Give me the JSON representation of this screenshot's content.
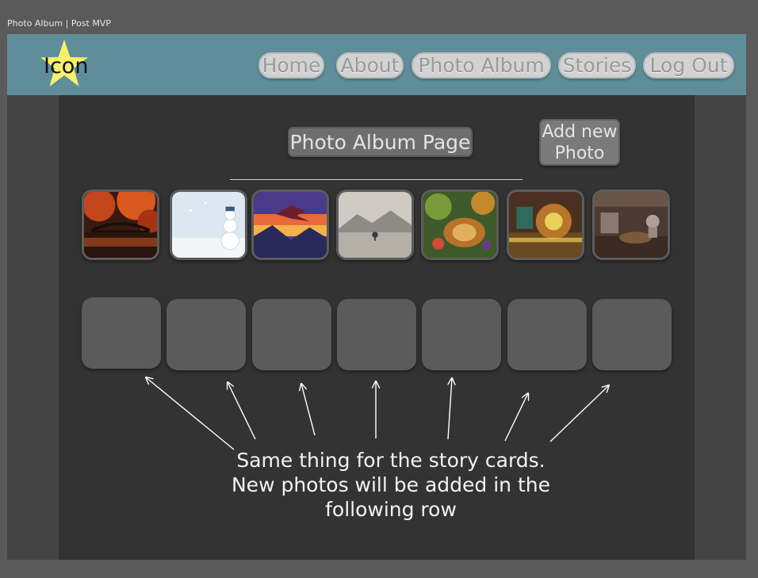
{
  "frame_label": "Photo Album | Post MVP",
  "header": {
    "logo_text": "Icon",
    "logo_color": "#f7f16a",
    "background": "#5f8e9a",
    "nav": [
      {
        "label": "Home"
      },
      {
        "label": "About"
      },
      {
        "label": "Photo Album"
      },
      {
        "label": "Stories"
      },
      {
        "label": "Log Out"
      }
    ]
  },
  "main": {
    "title_button": "Photo Album Page",
    "add_button": "Add new\nPhoto",
    "photos": [
      {
        "icon": "autumn-bridge-photo"
      },
      {
        "icon": "snowman-photo"
      },
      {
        "icon": "dragon-sunset-photo"
      },
      {
        "icon": "misty-landscape-photo"
      },
      {
        "icon": "fantasy-creature-photo"
      },
      {
        "icon": "fantasy-machine-photo"
      },
      {
        "icon": "tavern-interior-photo"
      }
    ],
    "story_cards": 7,
    "note_lines": [
      "Same thing for the story cards.",
      "New photos will be added in the",
      "following row"
    ]
  }
}
